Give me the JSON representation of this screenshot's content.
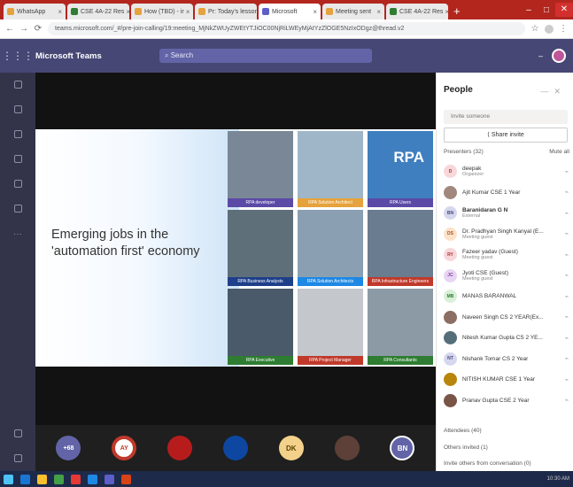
{
  "browser": {
    "tabs": [
      {
        "label": "WhatsApp",
        "icon": "whatsapp-icon",
        "active": false
      },
      {
        "label": "CSE 4A-22 Res",
        "icon": "sheets-icon",
        "active": false
      },
      {
        "label": "How (TBD) - ir",
        "icon": "page-icon",
        "active": false
      },
      {
        "label": "Pr: Today's lesson",
        "icon": "page-icon",
        "active": false
      },
      {
        "label": "Microsoft",
        "icon": "teams-icon",
        "active": true
      },
      {
        "label": "Meeting sent",
        "icon": "page-icon",
        "active": false
      },
      {
        "label": "CSE 4A-22 Res",
        "icon": "sheets-icon",
        "active": false
      }
    ],
    "new_tab": "+",
    "url": "teams.microsoft.com/_#/pre-join-calling/19:meeting_MjNkZWUyZWEtYTJiOC00NjRiLWEyMjAtYzZlOGE5NzIxODgz@thread.v2"
  },
  "teams": {
    "app_title": "Microsoft Teams",
    "search_placeholder": "Search"
  },
  "slide": {
    "title": "Emerging jobs in the 'automation first' economy",
    "tiles": [
      {
        "label": "RPA developer",
        "bar": "#5b4aa6",
        "img": "#7a8796"
      },
      {
        "label": "RPA Solution Architect",
        "bar": "#e6a23c",
        "img": "#9fb6c9"
      },
      {
        "label": "RPA Users",
        "bar": "#5b4aa6",
        "img": "#3f7fbf"
      },
      {
        "label": "RPA Business Analysts",
        "bar": "#1e3f8a",
        "img": "#5f6f7a"
      },
      {
        "label": "RPA Solution Architects",
        "bar": "#1e88e5",
        "img": "#8aa0b2"
      },
      {
        "label": "RPA Infrastructure Engineers",
        "bar": "#c0392b",
        "img": "#6a7c8f"
      },
      {
        "label": "RPA Executive",
        "bar": "#2e7d32",
        "img": "#4a5a6a"
      },
      {
        "label": "RPA Project Manager",
        "bar": "#c0392b",
        "img": "#c4c8cc"
      },
      {
        "label": "RPA Consultants",
        "bar": "#2e7d32",
        "img": "#8c9aa6"
      }
    ],
    "rpa_text": "RPA"
  },
  "tray": [
    {
      "initials": "+68",
      "style": "count"
    },
    {
      "initials": "AY",
      "style": "ay"
    },
    {
      "initials": "",
      "style": "red"
    },
    {
      "initials": "",
      "style": "dark"
    },
    {
      "initials": "DK",
      "style": "dk"
    },
    {
      "initials": "",
      "style": "photo"
    },
    {
      "initials": "BN",
      "style": "bn"
    }
  ],
  "people": {
    "title": "People",
    "invite_placeholder": "Invite someone",
    "share_invite": "Share invite",
    "presenters_header": "Presenters (32)",
    "mute_all": "Mute all",
    "participants": [
      {
        "initials": "D",
        "name": "deepak",
        "role": "Organizer",
        "bold": false,
        "color": "#f8d7da",
        "fg": "#a33"
      },
      {
        "initials": "",
        "name": "Ajit Kumar CSE 1 Year",
        "role": "",
        "bold": false,
        "color": "#a1887f",
        "fg": "#fff"
      },
      {
        "initials": "BN",
        "name": "Baranidaran G N",
        "role": "External",
        "bold": true,
        "color": "#d6d7ef",
        "fg": "#464775"
      },
      {
        "initials": "DS",
        "name": "Dr. Pradhyan Singh Kanyal (E...",
        "role": "Meeting guest",
        "bold": false,
        "color": "#fde2c8",
        "fg": "#a0522d"
      },
      {
        "initials": "RY",
        "name": "Fazeer yadav (Guest)",
        "role": "Meeting guest",
        "bold": false,
        "color": "#f8d7da",
        "fg": "#a33"
      },
      {
        "initials": "JC",
        "name": "Jyoti CSE (Guest)",
        "role": "Meeting guest",
        "bold": false,
        "color": "#e8d5f2",
        "fg": "#7b3fa0"
      },
      {
        "initials": "MB",
        "name": "MANAS BARANWAL",
        "role": "",
        "bold": false,
        "color": "#d8f0d8",
        "fg": "#2e7d32"
      },
      {
        "initials": "",
        "name": "Naveen Singh CS 2 YEAR(Ex...",
        "role": "",
        "bold": false,
        "color": "#8d6e63",
        "fg": "#fff"
      },
      {
        "initials": "",
        "name": "Nitesh Kumar Gupta CS 2 YE...",
        "role": "",
        "bold": false,
        "color": "#546e7a",
        "fg": "#fff"
      },
      {
        "initials": "NT",
        "name": "Nishank Tomar CS 2 Year",
        "role": "",
        "bold": false,
        "color": "#d6d7ef",
        "fg": "#464775"
      },
      {
        "initials": "",
        "name": "NITISH KUMAR CSE 1 Year",
        "role": "",
        "bold": false,
        "color": "#b8860b",
        "fg": "#fff"
      },
      {
        "initials": "",
        "name": "Pranav Gupta CSE 2 Year",
        "role": "",
        "bold": false,
        "color": "#795548",
        "fg": "#fff"
      }
    ],
    "attendees_header": "Attendees (40)",
    "others_invited": "Others invited (1)",
    "invite_from_conversation": "Invite others from conversation (0)"
  },
  "taskbar": {
    "clock": "10:30 AM"
  }
}
